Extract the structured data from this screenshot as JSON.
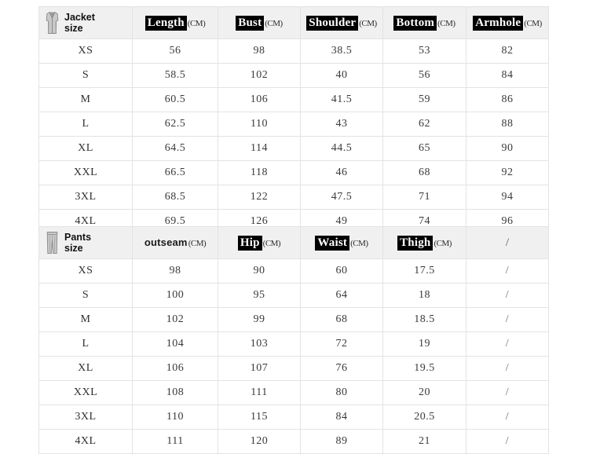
{
  "jacket": {
    "category_label": "Jacket size",
    "category_line1": "Jacket",
    "category_line2": "size",
    "icon": "jacket-vest-icon",
    "columns": [
      {
        "label": "Length",
        "unit": "(CM)",
        "highlight": true
      },
      {
        "label": "Bust",
        "unit": "(CM)",
        "highlight": true
      },
      {
        "label": "Shoulder",
        "unit": "(CM)",
        "highlight": true
      },
      {
        "label": "Bottom",
        "unit": "(CM)",
        "highlight": true
      },
      {
        "label": "Armhole",
        "unit": "(CM)",
        "highlight": true
      }
    ],
    "rows": [
      {
        "size": "XS",
        "values": [
          "56",
          "98",
          "38.5",
          "53",
          "82"
        ]
      },
      {
        "size": "S",
        "values": [
          "58.5",
          "102",
          "40",
          "56",
          "84"
        ]
      },
      {
        "size": "M",
        "values": [
          "60.5",
          "106",
          "41.5",
          "59",
          "86"
        ]
      },
      {
        "size": "L",
        "values": [
          "62.5",
          "110",
          "43",
          "62",
          "88"
        ]
      },
      {
        "size": "XL",
        "values": [
          "64.5",
          "114",
          "44.5",
          "65",
          "90"
        ]
      },
      {
        "size": "XXL",
        "values": [
          "66.5",
          "118",
          "46",
          "68",
          "92"
        ]
      },
      {
        "size": "3XL",
        "values": [
          "68.5",
          "122",
          "47.5",
          "71",
          "94"
        ]
      },
      {
        "size": "4XL",
        "values": [
          "69.5",
          "126",
          "49",
          "74",
          "96"
        ]
      }
    ]
  },
  "pants": {
    "category_label": "Pants size",
    "category_line1": "Pants",
    "category_line2": "size",
    "icon": "pants-trousers-icon",
    "columns": [
      {
        "label": "outseam",
        "unit": "(CM)",
        "highlight": false
      },
      {
        "label": "Hip",
        "unit": "(CM)",
        "highlight": true
      },
      {
        "label": "Waist",
        "unit": "(CM)",
        "highlight": true
      },
      {
        "label": "Thigh",
        "unit": "(CM)",
        "highlight": true
      },
      {
        "label": "/",
        "unit": "",
        "highlight": false
      }
    ],
    "rows": [
      {
        "size": "XS",
        "values": [
          "98",
          "90",
          "60",
          "17.5",
          "/"
        ]
      },
      {
        "size": "S",
        "values": [
          "100",
          "95",
          "64",
          "18",
          "/"
        ]
      },
      {
        "size": "M",
        "values": [
          "102",
          "99",
          "68",
          "18.5",
          "/"
        ]
      },
      {
        "size": "L",
        "values": [
          "104",
          "103",
          "72",
          "19",
          "/"
        ]
      },
      {
        "size": "XL",
        "values": [
          "106",
          "107",
          "76",
          "19.5",
          "/"
        ]
      },
      {
        "size": "XXL",
        "values": [
          "108",
          "111",
          "80",
          "20",
          "/"
        ]
      },
      {
        "size": "3XL",
        "values": [
          "110",
          "115",
          "84",
          "20.5",
          "/"
        ]
      },
      {
        "size": "4XL",
        "values": [
          "111",
          "120",
          "89",
          "21",
          "/"
        ]
      }
    ]
  },
  "colors": {
    "highlight_bg": "#000000",
    "highlight_fg": "#ffffff",
    "header_bg": "#f0f0f0",
    "border": "#e3e3e3",
    "text": "#3a3a3a",
    "page_bg": "#ffffff"
  }
}
